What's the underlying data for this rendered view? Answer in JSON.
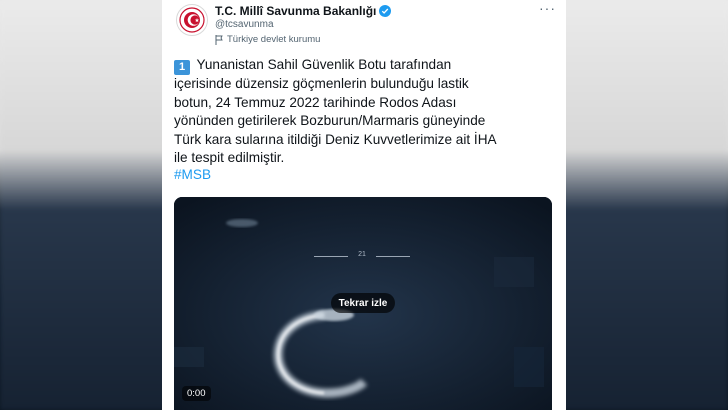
{
  "account": {
    "name": "T.C. Millî Savunma Bakanlığı",
    "handle": "@tcsavunma",
    "label": "Türkiye devlet kurumu",
    "verified": true,
    "avatar_icon": "turkish-emblem-icon"
  },
  "tweet": {
    "number_badge": "1",
    "text": "Yunanistan Sahil Güvenlik Botu tarafından\niçerisinde düzensiz göçmenlerin bulunduğu lastik\nbotun, 24 Temmuz 2022 tarihinde Rodos Adası\nyönünden getirilerek Bozburun/Marmaris güneyinde\nTürk kara sularına itildiği Deniz Kuvvetlerimize ait İHA\nile tespit edilmiştir.",
    "hashtag": "#MSB"
  },
  "video": {
    "replay_label": "Tekrar izle",
    "timestamp": "0:00",
    "hud_value": "21"
  },
  "colors": {
    "link": "#1d9bf0",
    "badge": "#3b94d9",
    "video_bg": "#0f1a2a"
  }
}
